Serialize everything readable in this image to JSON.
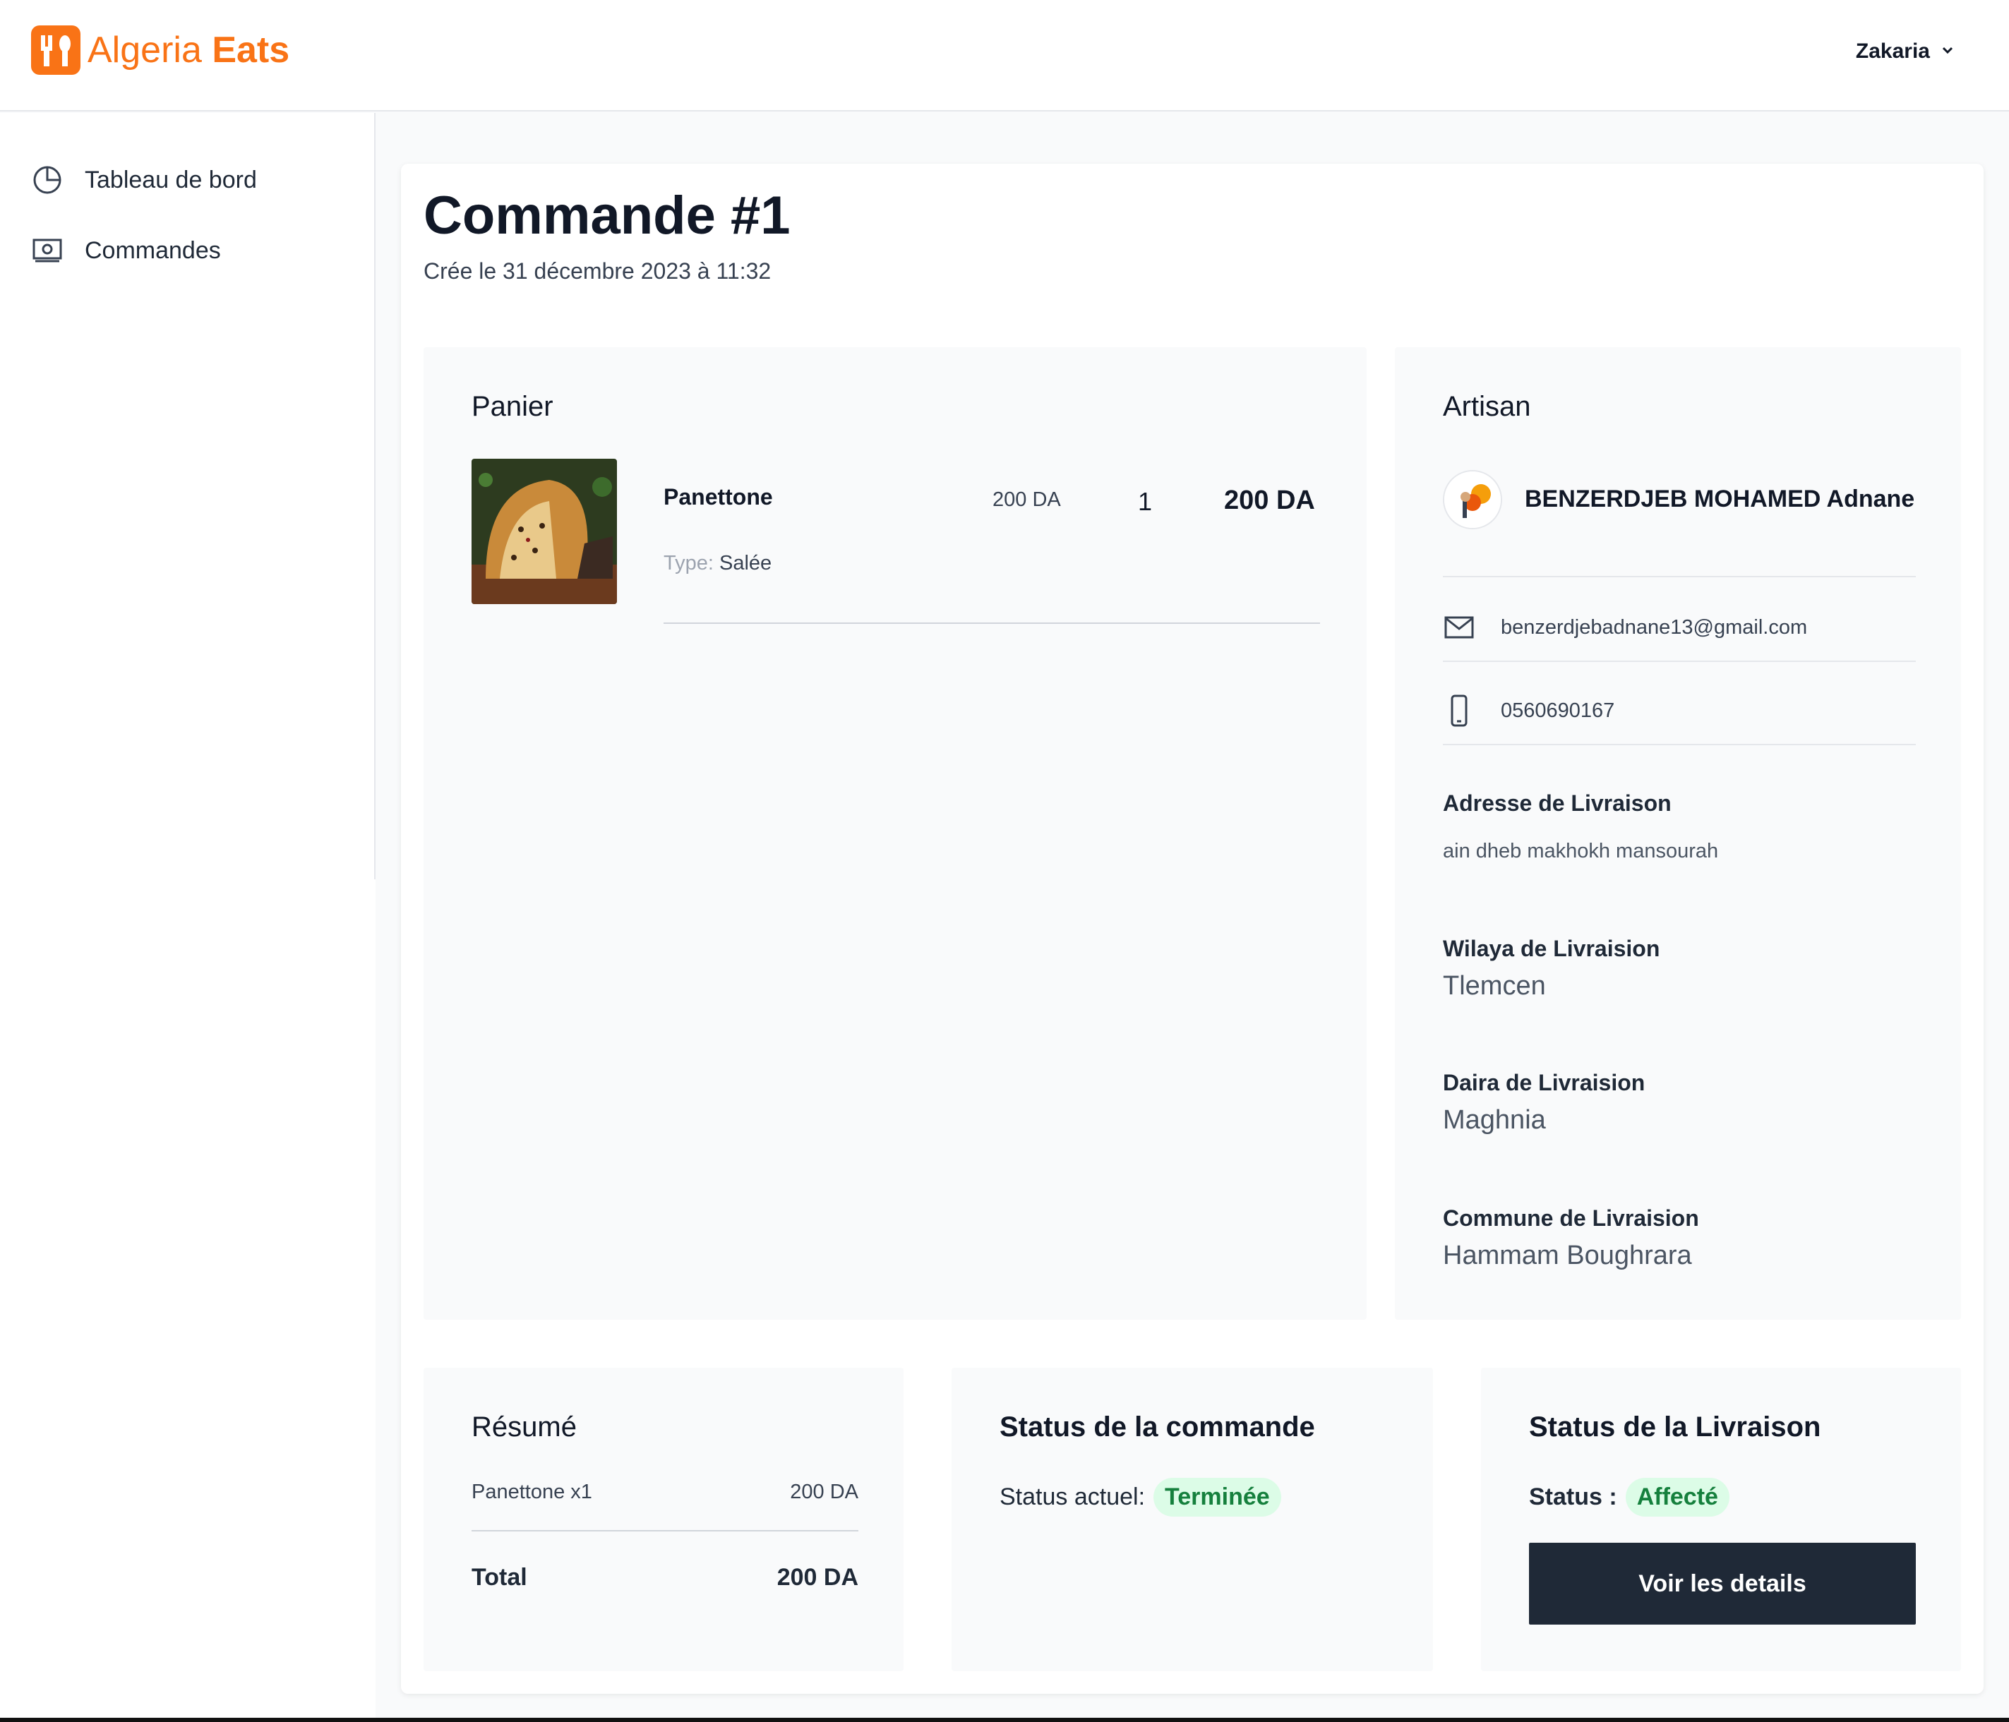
{
  "app": {
    "logo_text_part1": "Algeria",
    "logo_text_part2": "Eats",
    "user_name": "Zakaria"
  },
  "sidebar": {
    "items": [
      {
        "label": "Tableau de bord",
        "icon": "pie-chart-icon"
      },
      {
        "label": "Commandes",
        "icon": "money-bill-icon"
      }
    ]
  },
  "order": {
    "title": "Commande #1",
    "created": "Crée le 31 décembre 2023 à 11:32"
  },
  "cart": {
    "title": "Panier",
    "items": [
      {
        "name": "Panettone",
        "type_label": "Type:",
        "type_value": "Salée",
        "price": "200 DA",
        "quantity": "1",
        "total": "200 DA"
      }
    ]
  },
  "artisan": {
    "title": "Artisan",
    "name": "BENZERDJEB MOHAMED Adnane",
    "email": "benzerdjebadnane13@gmail.com",
    "phone": "0560690167",
    "address_label": "Adresse de Livraison",
    "address_value": "ain dheb makhokh mansourah",
    "wilaya_label": "Wilaya de Livraision",
    "wilaya_value": "Tlemcen",
    "daira_label": "Daira de Livraision",
    "daira_value": "Maghnia",
    "commune_label": "Commune de Livraision",
    "commune_value": "Hammam Boughrara"
  },
  "summary": {
    "title": "Résumé",
    "line_label": "Panettone x1",
    "line_value": "200 DA",
    "total_label": "Total",
    "total_value": "200 DA"
  },
  "order_status": {
    "title": "Status de la commande",
    "label": "Status actuel:",
    "value": "Terminée"
  },
  "delivery_status": {
    "title": "Status de la Livraison",
    "label": "Status :",
    "value": "Affecté",
    "button_label": "Voir les details"
  },
  "colors": {
    "brand": "#f97316",
    "dark_button": "#1f2937",
    "badge_bg": "#dcfce7",
    "badge_text": "#15803d"
  }
}
